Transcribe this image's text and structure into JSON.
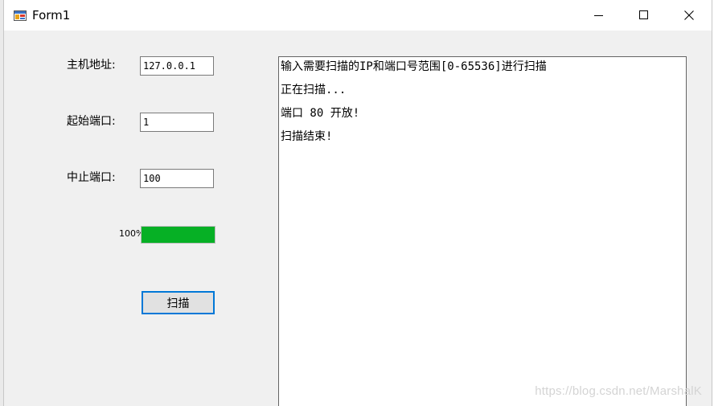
{
  "window": {
    "title": "Form1",
    "minimize_glyph": "—",
    "maximize_glyph": "☐",
    "close_glyph": "✕"
  },
  "form": {
    "host_label": "主机地址:",
    "host_value": "127.0.0.1",
    "start_port_label": "起始端口:",
    "start_port_value": "1",
    "end_port_label": "中止端口:",
    "end_port_value": "100",
    "progress_text": "100%",
    "progress_fraction": 1.0,
    "scan_button_label": "扫描"
  },
  "output": {
    "lines": [
      "输入需要扫描的IP和端口号范围[0-65536]进行扫描",
      "正在扫描...",
      "端口 80 开放!",
      "扫描结束!"
    ]
  },
  "watermark": "https://blog.csdn.net/MarshalK",
  "colors": {
    "progress_fill": "#06b025",
    "focus_border": "#0078d7"
  }
}
